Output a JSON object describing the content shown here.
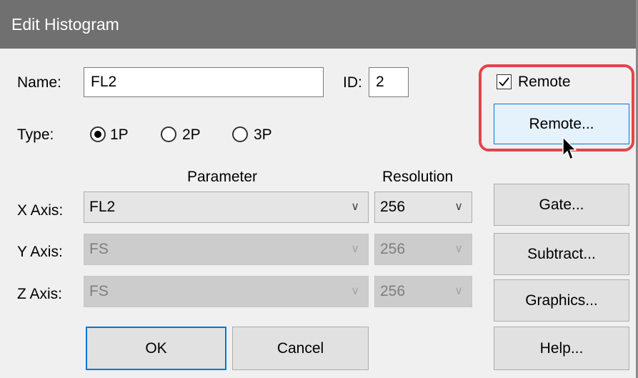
{
  "window": {
    "title": "Edit Histogram"
  },
  "name_field": {
    "label": "Name:",
    "value": "FL2"
  },
  "id_field": {
    "label": "ID:",
    "value": "2"
  },
  "type": {
    "label": "Type:",
    "options": [
      "1P",
      "2P",
      "3P"
    ],
    "selected": "1P"
  },
  "columns": {
    "parameter": "Parameter",
    "resolution": "Resolution"
  },
  "axes": [
    {
      "label": "X Axis:",
      "parameter": "FL2",
      "resolution": "256",
      "enabled": true
    },
    {
      "label": "Y Axis:",
      "parameter": "FS",
      "resolution": "256",
      "enabled": false
    },
    {
      "label": "Z Axis:",
      "parameter": "FS",
      "resolution": "256",
      "enabled": false
    }
  ],
  "remote": {
    "checkbox_label": "Remote",
    "checked": true,
    "button_label": "Remote..."
  },
  "buttons": {
    "gate": "Gate...",
    "subtract": "Subtract...",
    "graphics": "Graphics...",
    "help": "Help...",
    "ok": "OK",
    "cancel": "Cancel"
  },
  "icons": {
    "combo_arrow": "chevron-down-icon",
    "checkmark": "check-icon",
    "cursor": "mouse-pointer-icon"
  },
  "colors": {
    "titlebar": "#707070",
    "accent": "#0078d7",
    "highlight": "#e0454e",
    "dialog_bg": "#f0f0f0"
  }
}
